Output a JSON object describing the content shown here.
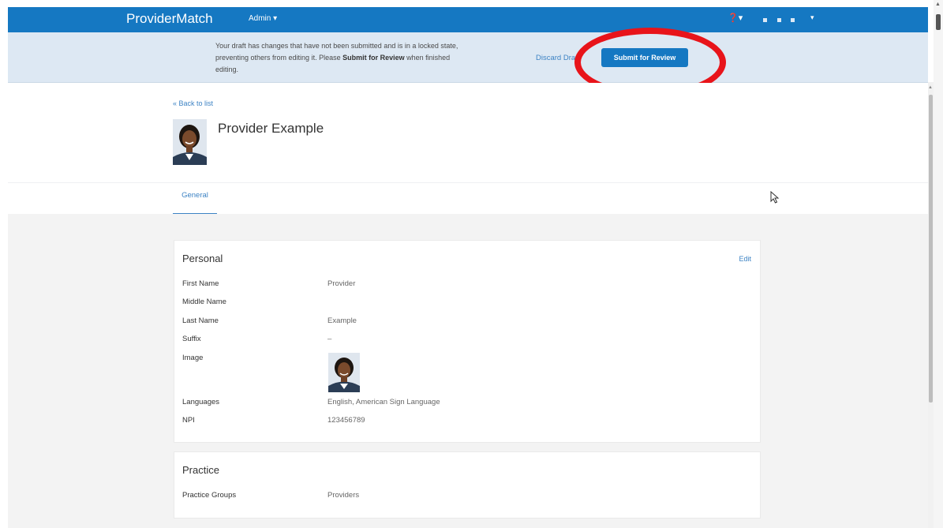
{
  "app": {
    "brand": "ProviderMatch",
    "admin_menu": "Admin ▾",
    "help": "❓▾",
    "user_caret": "▾"
  },
  "draft_bar": {
    "line1": "Your draft has changes that have not been submitted and is in a locked state,",
    "line2_pre": "preventing others from editing it. Please ",
    "line2_bold": "Submit for Review",
    "line2_post": " when finished",
    "line3": "editing.",
    "discard_label": "Discard Draft",
    "submit_label": "Submit for Review"
  },
  "annotation": {
    "color": "#e8141a"
  },
  "header": {
    "back_label": "« Back to list",
    "provider_name": "Provider Example"
  },
  "tabs": [
    {
      "label": "General",
      "active": true
    }
  ],
  "personal": {
    "title": "Personal",
    "edit_label": "Edit",
    "fields": [
      {
        "label": "First Name",
        "value": "Provider"
      },
      {
        "label": "Middle Name",
        "value": ""
      },
      {
        "label": "Last Name",
        "value": "Example"
      },
      {
        "label": "Suffix",
        "value": "–"
      },
      {
        "label": "Image",
        "value": ""
      },
      {
        "label": "Languages",
        "value": "English, American Sign Language"
      },
      {
        "label": "NPI",
        "value": "123456789"
      }
    ]
  },
  "practice": {
    "title": "Practice",
    "fields": [
      {
        "label": "Practice Groups",
        "value": "Providers"
      }
    ]
  },
  "colors": {
    "navbar": "#1578c2",
    "draft_bar": "#dde8f3",
    "link": "#3d83c4",
    "page_bg": "#f3f3f3"
  }
}
